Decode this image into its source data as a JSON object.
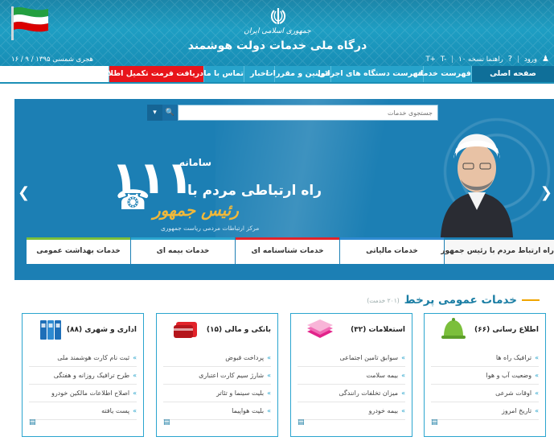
{
  "header": {
    "emblem_text": "جمهوری اسلامی ایران",
    "portal_title": "درگاه ملی خدمات دولت هوشمند",
    "date": "هجری شمسی ۱۳۹۵ / ۹ / ۱۶",
    "login": "ورود",
    "help": "راهنما نسخه ۱۰",
    "font_small": "T-",
    "font_large": "T+"
  },
  "nav": {
    "items": [
      "صفحه اصلی",
      "فهرست خدمات",
      "فهرست دستگاه های اجرائی",
      "قوانین و مقررات",
      "اخبار",
      "تماس با ما",
      "دریافت فرمت تکمیل اطلاعات درگاه"
    ]
  },
  "banner": {
    "search_placeholder": "جستجوی خدمات",
    "number": "۱۱۱",
    "system_label": "سامانه",
    "slogan": "راه ارتباطی مردم با",
    "slogan_sub": "رئیس جمهور",
    "center_label": "مرکز ارتباطات مردمی ریاست جمهوری",
    "tabs": [
      {
        "label": "راه ارتباط مردم با رئیس جمهور",
        "color": "#1c7fb4"
      },
      {
        "label": "خدمات مالیاتی",
        "color": "#2e8ad1"
      },
      {
        "label": "خدمات شناسنامه ای",
        "color": "#e2232a"
      },
      {
        "label": "خدمات بیمه ای",
        "color": "#2ba5cf"
      },
      {
        "label": "خدمات بهداشت عمومی",
        "color": "#7bbf3b"
      }
    ]
  },
  "services": {
    "title": "خدمات عمومی پرخط",
    "count": "(۲۰۱ خدمت)",
    "cards": [
      {
        "title": "اطلاع رسانی (۶۶)",
        "icon": "bell-icon",
        "items": [
          "ترافیک راه ها",
          "وضعیت آب و هوا",
          "اوقات شرعی",
          "تاریخ امروز"
        ]
      },
      {
        "title": "استعلامات (۳۲)",
        "icon": "papers-icon",
        "items": [
          "سوابق تامین اجتماعی",
          "بیمه سلامت",
          "میزان تخلفات رانندگی",
          "بیمه خودرو"
        ]
      },
      {
        "title": "بانکی و مالی (۱۵)",
        "icon": "wallet-icon",
        "items": [
          "پرداخت قبوض",
          "شارژ سیم کارت اعتباری",
          "بلیت سینما و تئاتر",
          "بلیت هواپیما"
        ]
      },
      {
        "title": "اداری و شهری (۸۸)",
        "icon": "binders-icon",
        "items": [
          "ثبت نام کارت هوشمند ملی",
          "طرح ترافیک روزانه و هفتگی",
          "اصلاح اطلاعات مالکین خودرو",
          "پست یافته"
        ]
      }
    ]
  }
}
